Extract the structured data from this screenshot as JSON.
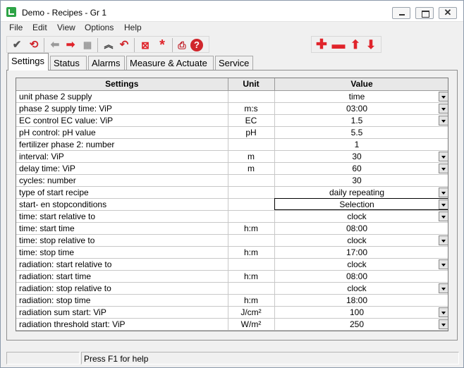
{
  "window": {
    "title": "Demo - Recipes - Gr 1"
  },
  "menu": [
    "File",
    "Edit",
    "View",
    "Options",
    "Help"
  ],
  "toolbar": {
    "icons": [
      "checkmark-icon",
      "refresh-icon",
      "arrow-left-icon",
      "arrow-right-icon",
      "grid-icon",
      "collapse-icon",
      "undo-icon",
      "delete-box-icon",
      "asterisk-icon",
      "print-icon",
      "help-icon"
    ],
    "row_icons": [
      "plus-icon",
      "minus-icon",
      "arrow-up-icon",
      "arrow-down-icon"
    ]
  },
  "tabs": [
    "Settings",
    "Status",
    "Alarms",
    "Measure & Actuate",
    "Service"
  ],
  "active_tab": "Settings",
  "grid": {
    "headers": [
      "Settings",
      "Unit",
      "Value"
    ],
    "rows": [
      {
        "setting": "unit phase 2 supply",
        "unit": "",
        "value": "time",
        "dropdown": true
      },
      {
        "setting": "phase 2 supply time: ViP",
        "unit": "m:s",
        "value": "03:00",
        "dropdown": true
      },
      {
        "setting": "EC control EC value: ViP",
        "unit": "EC",
        "value": "1.5",
        "dropdown": true
      },
      {
        "setting": "pH control: pH value",
        "unit": "pH",
        "value": "5.5",
        "dropdown": false
      },
      {
        "setting": "fertilizer phase 2: number",
        "unit": "",
        "value": "1",
        "dropdown": false
      },
      {
        "setting": "interval: ViP",
        "unit": "m",
        "value": "30",
        "dropdown": true
      },
      {
        "setting": "delay time: ViP",
        "unit": "m",
        "value": "60",
        "dropdown": true
      },
      {
        "setting": "cycles: number",
        "unit": "",
        "value": "30",
        "dropdown": false
      },
      {
        "setting": "type of start recipe",
        "unit": "",
        "value": "daily repeating",
        "dropdown": true
      },
      {
        "setting": "start- en stopconditions",
        "unit": "",
        "value": "Selection",
        "dropdown": true,
        "selected": true
      },
      {
        "setting": "time: start relative to",
        "unit": "",
        "value": "clock",
        "dropdown": true
      },
      {
        "setting": "time: start time",
        "unit": "h:m",
        "value": "08:00",
        "dropdown": false
      },
      {
        "setting": "time: stop relative to",
        "unit": "",
        "value": "clock",
        "dropdown": true
      },
      {
        "setting": "time: stop time",
        "unit": "h:m",
        "value": "17:00",
        "dropdown": false
      },
      {
        "setting": "radiation: start relative to",
        "unit": "",
        "value": "clock",
        "dropdown": true
      },
      {
        "setting": "radiation: start time",
        "unit": "h:m",
        "value": "08:00",
        "dropdown": false
      },
      {
        "setting": "radiation: stop relative to",
        "unit": "",
        "value": "clock",
        "dropdown": true
      },
      {
        "setting": "radiation: stop time",
        "unit": "h:m",
        "value": "18:00",
        "dropdown": false
      },
      {
        "setting": "radiation sum start: ViP",
        "unit": "J/cm²",
        "value": "100",
        "dropdown": true
      },
      {
        "setting": "radiation threshold start: ViP",
        "unit": "W/m²",
        "value": "250",
        "dropdown": true
      }
    ]
  },
  "status": {
    "help_text": "Press F1 for help"
  },
  "colors": {
    "green": "#2ea447",
    "red": "#e0242b",
    "blue_arrow": "#1f5fbf"
  }
}
